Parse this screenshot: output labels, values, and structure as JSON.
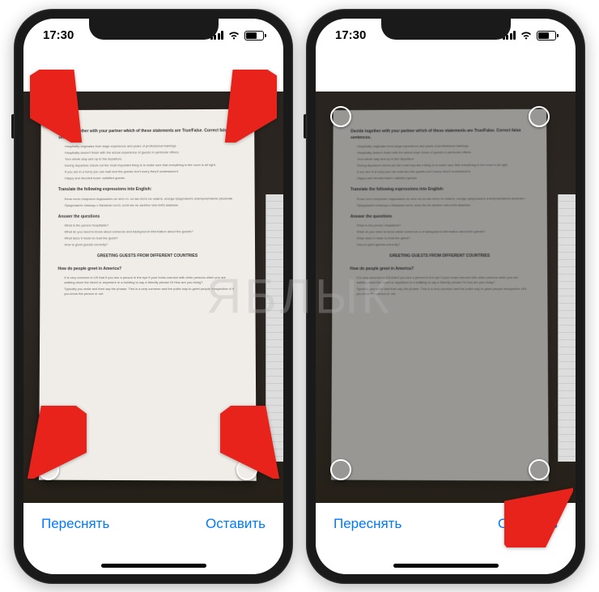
{
  "status": {
    "time": "17:30"
  },
  "buttons": {
    "retake": "Переснять",
    "keep": "Оставить"
  },
  "document": {
    "title1": "Decide together with your partner which of these statements are True/False. Correct false sentences.",
    "title2": "Translate the following expressions into English:",
    "title3": "Answer the questions",
    "title4": "GREETING GUESTS FROM DIFFERENT COUNTRIES",
    "title5": "How do people greet in America?"
  },
  "watermark": "ЯБЛЫК",
  "colors": {
    "ios_blue": "#007aff",
    "arrow_red": "#e8231c"
  }
}
